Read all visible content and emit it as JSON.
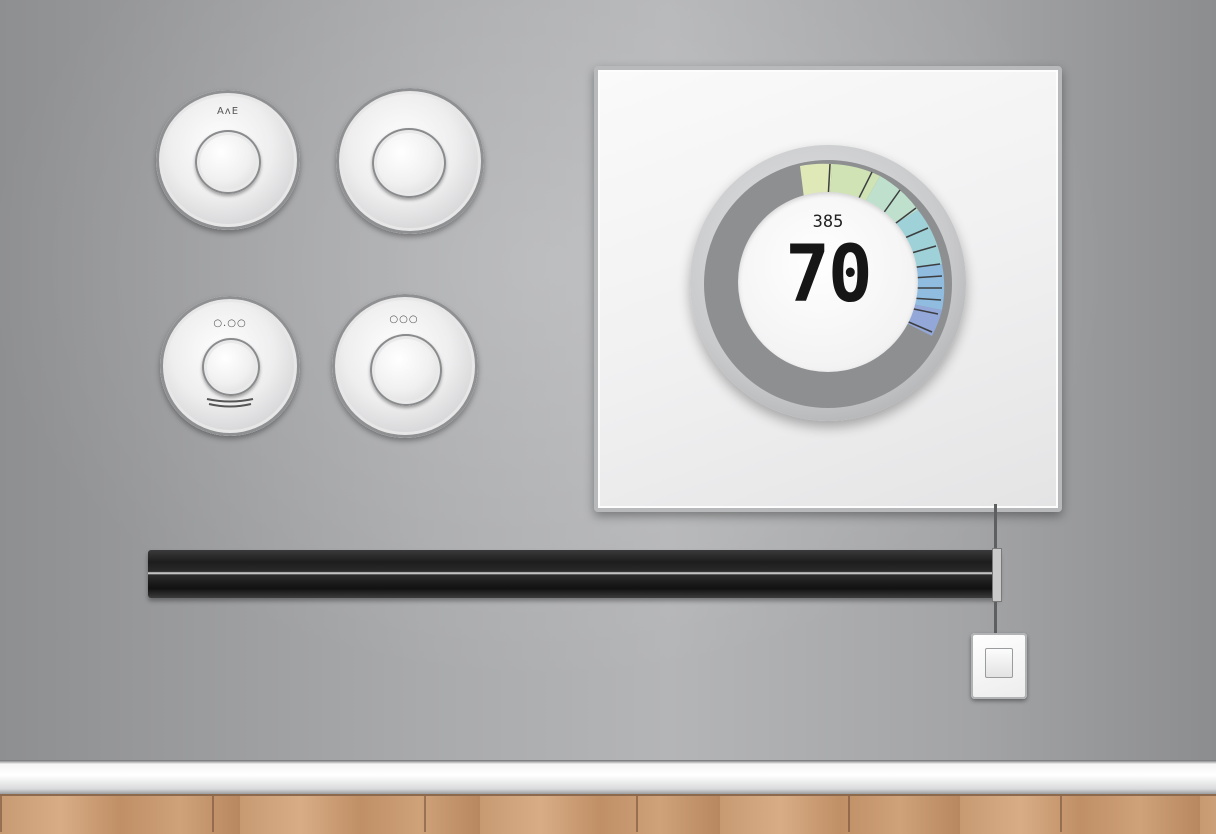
{
  "scene": {
    "wall_color": "#a9aaac",
    "floor_color": "#cfa27a",
    "baseboard_color": "#ffffff"
  },
  "knobs": [
    {
      "id": "top-left",
      "label": "AʌE"
    },
    {
      "id": "top-right",
      "label": ""
    },
    {
      "id": "bottom-left",
      "label": "○.○○"
    },
    {
      "id": "bottom-right",
      "label": "○○○"
    }
  ],
  "thermostat": {
    "small_readout": "385",
    "big_readout": "70",
    "scale_colors": [
      "#cfe3b4",
      "#bfe0cd",
      "#9fd1d8",
      "#8fbcdf",
      "#93a8d8"
    ]
  },
  "switch": {
    "state": "off"
  }
}
